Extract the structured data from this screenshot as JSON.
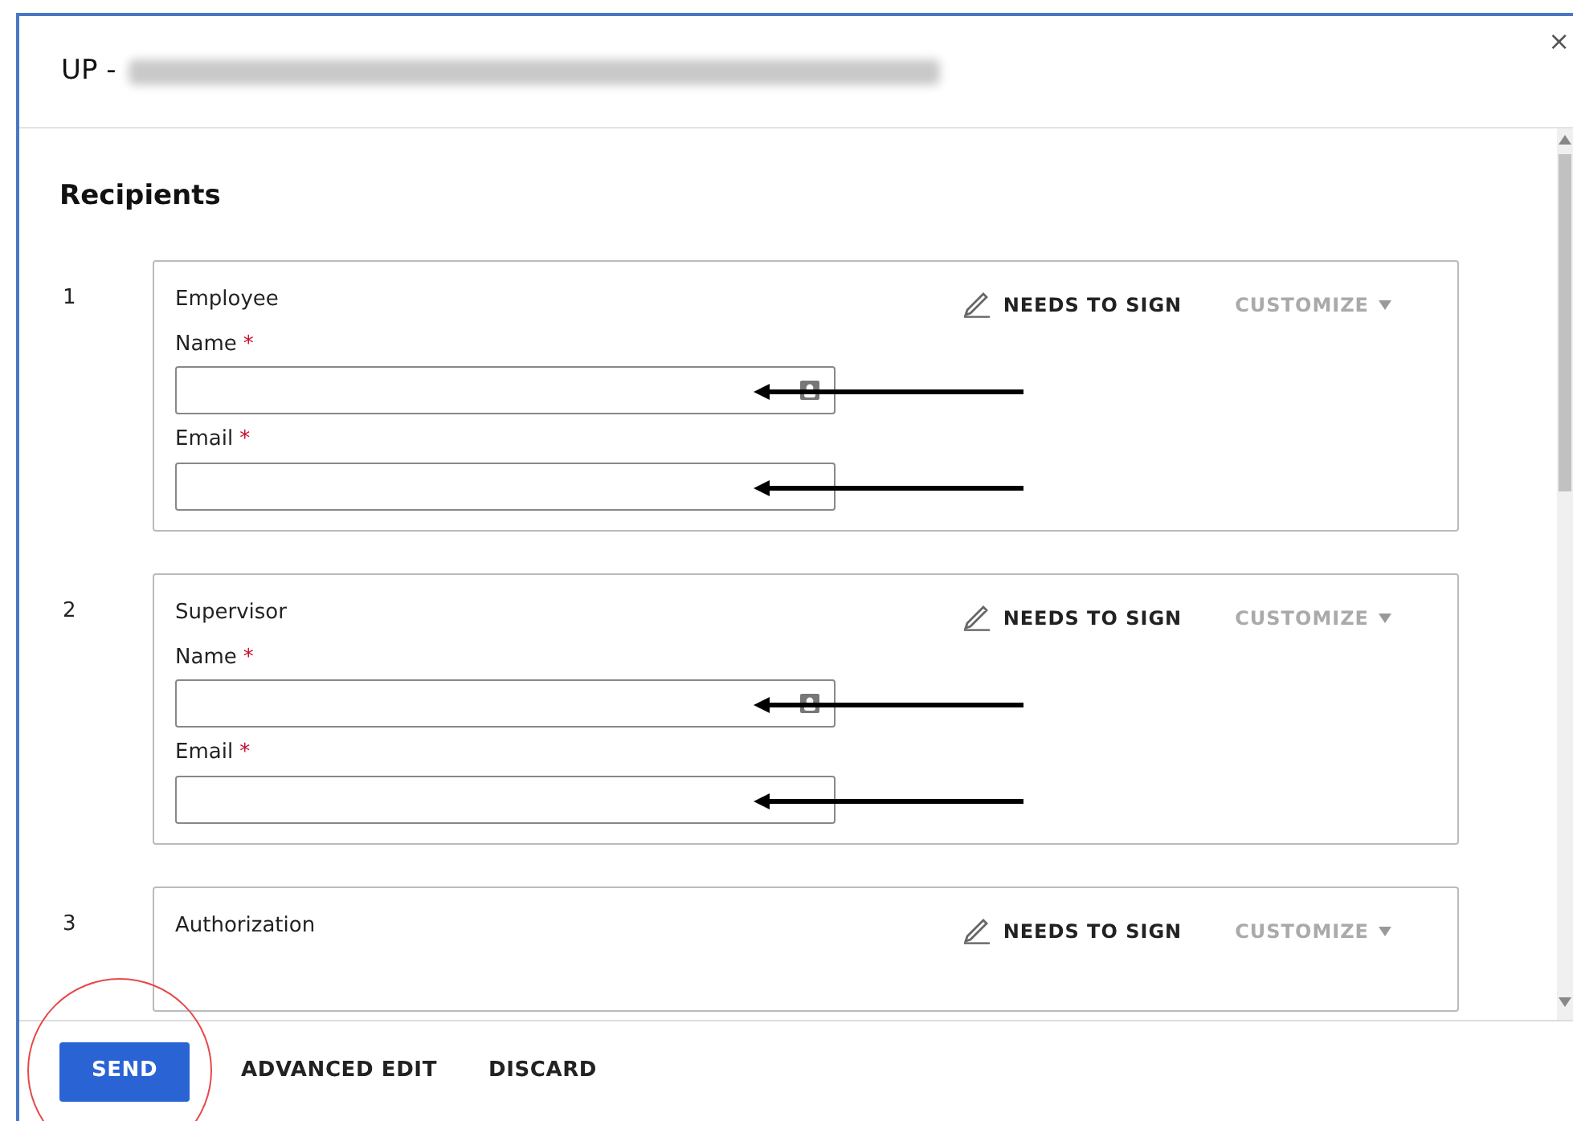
{
  "dialog": {
    "title_prefix": "UP -",
    "title_redacted": true,
    "close": "×"
  },
  "section_title": "Recipients",
  "recipients": [
    {
      "number": "1",
      "role": "Employee",
      "action": "NEEDS TO SIGN",
      "customize": "CUSTOMIZE",
      "fields": [
        {
          "label": "Name",
          "required_mark": "*",
          "contact_icon": true,
          "annotated": true
        },
        {
          "label": "Email",
          "required_mark": "*",
          "contact_icon": false,
          "annotated": true
        }
      ]
    },
    {
      "number": "2",
      "role": "Supervisor",
      "action": "NEEDS TO SIGN",
      "customize": "CUSTOMIZE",
      "fields": [
        {
          "label": "Name",
          "required_mark": "*",
          "contact_icon": true,
          "annotated": true
        },
        {
          "label": "Email",
          "required_mark": "*",
          "contact_icon": false,
          "annotated": true
        }
      ]
    },
    {
      "number": "3",
      "role": "Authorization",
      "action": "NEEDS TO SIGN",
      "customize": "CUSTOMIZE"
    }
  ],
  "footer_buttons": [
    {
      "label": "SEND",
      "kind": "primary",
      "highlighted": true
    },
    {
      "label": "ADVANCED EDIT",
      "kind": "text",
      "highlighted": false
    },
    {
      "label": "DISCARD",
      "kind": "text",
      "highlighted": false
    }
  ]
}
